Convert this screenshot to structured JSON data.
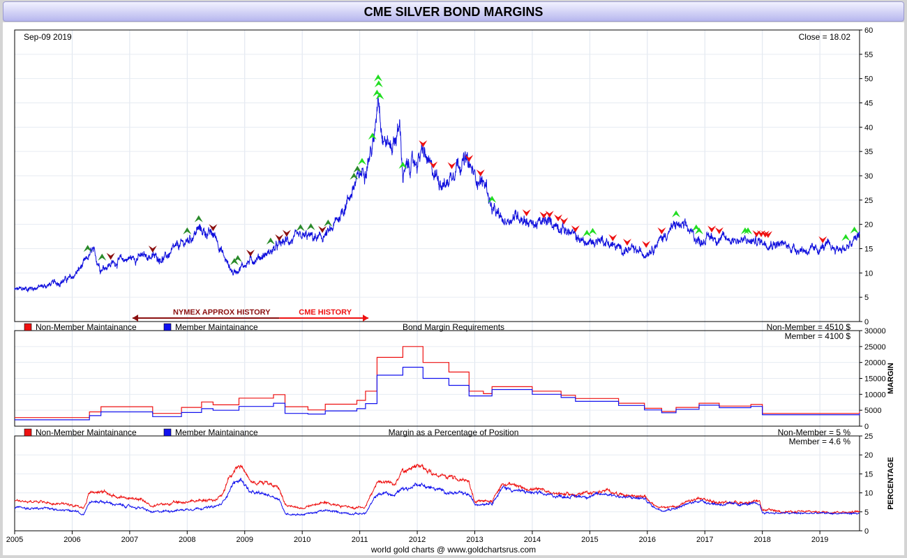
{
  "title": "CME SILVER BOND MARGINS",
  "footer": "world gold charts @ www.goldchartsrus.com",
  "chart_data": [
    {
      "type": "line",
      "panel": "price",
      "date_label": "Sep-09  2019",
      "close_label": "Close = 18.02",
      "ylim": [
        0,
        60
      ],
      "yticks": [
        0,
        5,
        10,
        15,
        20,
        25,
        30,
        35,
        40,
        45,
        50,
        55,
        60
      ],
      "grid": true,
      "color": "#1010dd",
      "series": [
        {
          "x": [
            2005.0,
            2005.5,
            2006.0,
            2006.25,
            2006.35,
            2006.5,
            2006.8,
            2007.0,
            2007.3,
            2007.6,
            2007.85,
            2008.0,
            2008.2,
            2008.5,
            2008.65,
            2008.8,
            2008.9,
            2009.1,
            2009.4,
            2009.7,
            2009.9,
            2010.1,
            2010.3,
            2010.5,
            2010.75,
            2010.95,
            2011.1,
            2011.25,
            2011.32,
            2011.4,
            2011.55,
            2011.7,
            2011.75,
            2011.85,
            2012.0,
            2012.1,
            2012.25,
            2012.5,
            2012.7,
            2012.85,
            2013.0,
            2013.2,
            2013.3,
            2013.5,
            2013.75,
            2014.0,
            2014.3,
            2014.5,
            2014.75,
            2014.95,
            2015.2,
            2015.5,
            2015.8,
            2015.95,
            2016.2,
            2016.5,
            2016.7,
            2016.9,
            2017.1,
            2017.3,
            2017.5,
            2017.7,
            2018.0,
            2018.3,
            2018.6,
            2018.9,
            2019.1,
            2019.3,
            2019.5,
            2019.69
          ],
          "y": [
            6.5,
            7.2,
            9.0,
            12.5,
            14.5,
            11.0,
            12.5,
            13.0,
            13.5,
            13.0,
            15.5,
            16.5,
            19.0,
            17.5,
            13.0,
            10.0,
            11.0,
            12.5,
            14.0,
            16.5,
            17.0,
            17.5,
            17.0,
            18.5,
            24.0,
            29.0,
            32.0,
            37.0,
            48.0,
            38.0,
            36.0,
            40.0,
            30.0,
            32.0,
            33.0,
            35.0,
            31.0,
            28.0,
            33.0,
            33.0,
            30.0,
            28.0,
            23.0,
            20.5,
            22.0,
            20.0,
            20.5,
            19.5,
            17.5,
            16.0,
            17.0,
            15.0,
            14.5,
            14.0,
            16.5,
            20.0,
            19.0,
            16.5,
            17.5,
            17.0,
            17.0,
            16.5,
            16.5,
            16.0,
            15.0,
            14.5,
            15.5,
            15.0,
            15.2,
            18.0
          ]
        }
      ],
      "annotations": {
        "nymex_label": "NYMEX APPROX HISTORY",
        "cme_label": "CME HISTORY",
        "increase_arrows_x": [
          2006.27,
          2006.52,
          2008.0,
          2008.2,
          2008.82,
          2008.88,
          2009.45,
          2009.97,
          2010.15,
          2010.45,
          2010.9,
          2010.96,
          2011.04,
          2011.22,
          2011.3,
          2011.32,
          2011.33,
          2011.35,
          2011.75,
          2013.3,
          2014.95,
          2015.05,
          2016.5,
          2016.85,
          2016.9,
          2017.7,
          2017.75,
          2019.45,
          2019.6
        ],
        "decrease_arrows_x": [
          2006.67,
          2007.4,
          2008.45,
          2009.1,
          2009.6,
          2009.73,
          2010.35,
          2012.1,
          2012.28,
          2012.6,
          2012.9,
          2013.1,
          2013.9,
          2014.2,
          2014.3,
          2014.45,
          2014.55,
          2014.75,
          2015.4,
          2015.65,
          2015.98,
          2016.25,
          2017.12,
          2017.25,
          2017.9,
          2017.98,
          2018.05,
          2018.1,
          2019.05
        ]
      }
    },
    {
      "type": "line",
      "panel": "margin",
      "title": "Bond Margin Requirements",
      "ylabel": "MARGIN",
      "ylim": [
        0,
        30000
      ],
      "yticks": [
        0,
        5000,
        10000,
        15000,
        20000,
        25000,
        30000
      ],
      "legend": [
        {
          "name": "Non-Member Maintainance",
          "color": "#ee1111"
        },
        {
          "name": "Member Maintainance",
          "color": "#1111ee"
        }
      ],
      "value_labels": [
        "Non-Member = 4510 $",
        "Member = 4100 $"
      ],
      "series": [
        {
          "name": "Non-Member Maintainance",
          "color": "#ee1111",
          "x": [
            2005.0,
            2006.25,
            2006.3,
            2006.5,
            2007.4,
            2007.9,
            2008.25,
            2008.45,
            2008.9,
            2009.5,
            2009.7,
            2010.1,
            2010.4,
            2010.95,
            2011.1,
            2011.3,
            2011.75,
            2012.1,
            2012.55,
            2012.9,
            2013.15,
            2013.3,
            2013.75,
            2014.0,
            2014.5,
            2014.75,
            2015.0,
            2015.5,
            2015.95,
            2016.25,
            2016.5,
            2016.9,
            2017.25,
            2017.8,
            2018.0,
            2018.5,
            2019.0,
            2019.5,
            2019.69
          ],
          "y": [
            2700,
            2700,
            4500,
            6100,
            4000,
            5900,
            7600,
            6700,
            8800,
            9900,
            6100,
            5100,
            6900,
            8100,
            11000,
            21600,
            25000,
            20000,
            17000,
            11000,
            10200,
            12400,
            12400,
            11000,
            9700,
            8700,
            8700,
            7200,
            5600,
            4600,
            5900,
            7200,
            6300,
            6800,
            4000,
            4000,
            4000,
            4000,
            4510
          ]
        },
        {
          "name": "Member Maintainance",
          "color": "#1111ee",
          "x": [
            2005.0,
            2006.25,
            2006.3,
            2006.5,
            2007.4,
            2007.9,
            2008.25,
            2008.45,
            2008.9,
            2009.5,
            2009.7,
            2010.1,
            2010.4,
            2010.95,
            2011.1,
            2011.3,
            2011.75,
            2012.1,
            2012.55,
            2012.9,
            2013.15,
            2013.3,
            2013.75,
            2014.0,
            2014.5,
            2014.75,
            2015.0,
            2015.5,
            2015.95,
            2016.25,
            2016.5,
            2016.9,
            2017.25,
            2017.8,
            2018.0,
            2018.5,
            2019.0,
            2019.5,
            2019.69
          ],
          "y": [
            2000,
            2000,
            3300,
            4500,
            3000,
            4300,
            5500,
            5000,
            6200,
            7200,
            4000,
            3800,
            4800,
            5500,
            7100,
            16000,
            18500,
            15000,
            12800,
            9500,
            9500,
            11500,
            11500,
            10000,
            9000,
            7800,
            7800,
            6500,
            5100,
            4200,
            5300,
            6600,
            5800,
            6200,
            3600,
            3600,
            3600,
            3600,
            4100
          ]
        }
      ]
    },
    {
      "type": "line",
      "panel": "percentage",
      "title": "Margin as a Percentage of Position",
      "ylabel": "PERCENTAGE",
      "ylim": [
        0,
        25
      ],
      "yticks": [
        0,
        5,
        10,
        15,
        20,
        25
      ],
      "legend": [
        {
          "name": "Non-Member Maintainance",
          "color": "#ee1111"
        },
        {
          "name": "Member Maintainance",
          "color": "#1111ee"
        }
      ],
      "value_labels": [
        "Non-Member = 5 %",
        "Member = 4.6 %"
      ],
      "x_ticks": [
        "2005",
        "2006",
        "2007",
        "2008",
        "2009",
        "2010",
        "2011",
        "2012",
        "2013",
        "2014",
        "2015",
        "2016",
        "2017",
        "2018",
        "2019"
      ],
      "series": [
        {
          "name": "Non-Member Maintainance",
          "color": "#ee1111",
          "x": [
            2005.0,
            2005.5,
            2006.0,
            2006.2,
            2006.3,
            2006.5,
            2006.8,
            2007.2,
            2007.4,
            2007.6,
            2007.9,
            2008.2,
            2008.45,
            2008.6,
            2008.8,
            2008.95,
            2009.1,
            2009.4,
            2009.6,
            2009.7,
            2010.0,
            2010.4,
            2010.9,
            2011.1,
            2011.3,
            2011.45,
            2011.6,
            2011.75,
            2011.85,
            2012.0,
            2012.3,
            2012.6,
            2012.9,
            2013.0,
            2013.3,
            2013.5,
            2013.75,
            2014.0,
            2014.4,
            2014.7,
            2015.0,
            2015.3,
            2015.6,
            2015.95,
            2016.1,
            2016.25,
            2016.5,
            2016.9,
            2017.2,
            2017.6,
            2017.95,
            2018.0,
            2018.5,
            2019.0,
            2019.5,
            2019.69
          ],
          "y": [
            8.0,
            7.5,
            7.0,
            6.0,
            10.0,
            10.5,
            9.0,
            8.0,
            6.5,
            7.0,
            7.5,
            8.0,
            8.0,
            9.5,
            16.0,
            17.5,
            13.0,
            12.5,
            11.5,
            7.0,
            6.0,
            7.5,
            6.0,
            6.5,
            12.5,
            13.0,
            12.0,
            16.0,
            15.5,
            17.0,
            15.0,
            14.0,
            13.0,
            7.5,
            8.0,
            12.5,
            11.5,
            11.0,
            10.0,
            9.5,
            10.0,
            10.5,
            9.5,
            9.0,
            7.0,
            6.0,
            6.5,
            8.5,
            7.5,
            7.5,
            7.5,
            5.5,
            5.0,
            5.0,
            5.0,
            5.0
          ]
        },
        {
          "name": "Member Maintainance",
          "color": "#1111ee",
          "x": [
            2005.0,
            2005.5,
            2006.0,
            2006.2,
            2006.3,
            2006.5,
            2006.8,
            2007.2,
            2007.4,
            2007.6,
            2007.9,
            2008.2,
            2008.45,
            2008.6,
            2008.8,
            2008.95,
            2009.1,
            2009.4,
            2009.6,
            2009.7,
            2010.0,
            2010.4,
            2010.9,
            2011.1,
            2011.3,
            2011.45,
            2011.6,
            2011.75,
            2011.85,
            2012.0,
            2012.3,
            2012.6,
            2012.9,
            2013.0,
            2013.3,
            2013.5,
            2013.75,
            2014.0,
            2014.4,
            2014.7,
            2015.0,
            2015.3,
            2015.6,
            2015.95,
            2016.1,
            2016.25,
            2016.5,
            2016.9,
            2017.2,
            2017.6,
            2017.95,
            2018.0,
            2018.5,
            2019.0,
            2019.5,
            2019.69
          ],
          "y": [
            6.0,
            5.8,
            5.3,
            4.5,
            7.5,
            7.8,
            6.8,
            6.0,
            4.8,
            5.2,
            5.5,
            6.0,
            6.2,
            7.0,
            12.5,
            13.5,
            10.0,
            9.5,
            8.5,
            4.5,
            4.3,
            5.3,
            4.5,
            4.6,
            9.5,
            10.0,
            9.2,
            11.5,
            11.0,
            12.5,
            11.0,
            10.0,
            9.5,
            7.0,
            7.5,
            11.5,
            10.5,
            10.0,
            9.2,
            9.0,
            9.2,
            9.8,
            8.8,
            8.5,
            6.3,
            5.5,
            6.0,
            8.0,
            7.0,
            7.0,
            7.0,
            4.8,
            4.6,
            4.6,
            4.6,
            4.6
          ]
        }
      ]
    }
  ]
}
